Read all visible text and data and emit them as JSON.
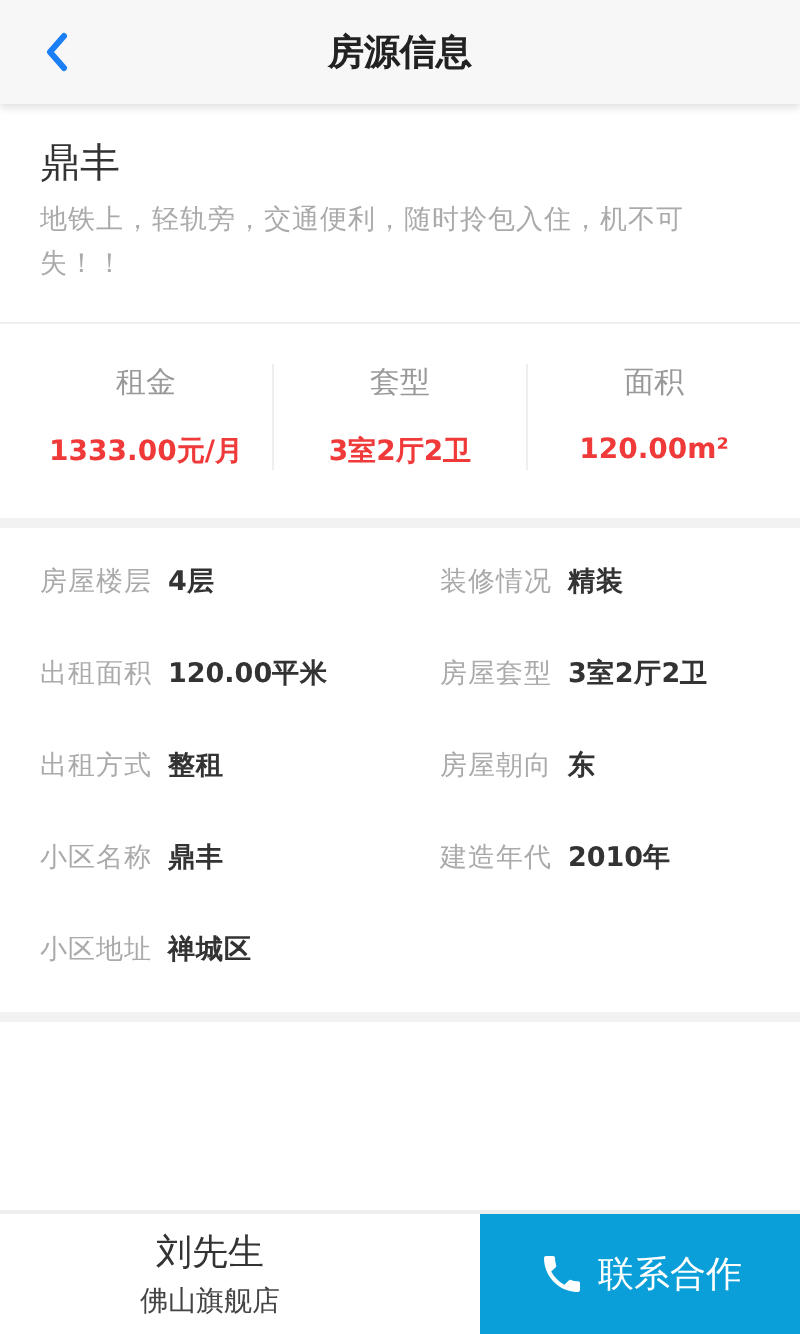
{
  "header": {
    "title": "房源信息"
  },
  "listing": {
    "name": "鼎丰",
    "description": "地铁上，轻轨旁，交通便利，随时拎包入住，机不可失！！"
  },
  "stats": [
    {
      "label": "租金",
      "value": "1333.00元/月"
    },
    {
      "label": "套型",
      "value": "3室2厅2卫"
    },
    {
      "label": "面积",
      "value": "120.00m²"
    }
  ],
  "details": [
    {
      "label": "房屋楼层",
      "value": "4层"
    },
    {
      "label": "装修情况",
      "value": "精装"
    },
    {
      "label": "出租面积",
      "value": "120.00平米"
    },
    {
      "label": "房屋套型",
      "value": "3室2厅2卫"
    },
    {
      "label": "出租方式",
      "value": "整租"
    },
    {
      "label": "房屋朝向",
      "value": "东"
    },
    {
      "label": "小区名称",
      "value": "鼎丰"
    },
    {
      "label": "建造年代",
      "value": "2010年"
    },
    {
      "label": "小区地址",
      "value": "禅城区"
    }
  ],
  "footer": {
    "contact_name": "刘先生",
    "store": "佛山旗舰店",
    "button": "联系合作"
  }
}
